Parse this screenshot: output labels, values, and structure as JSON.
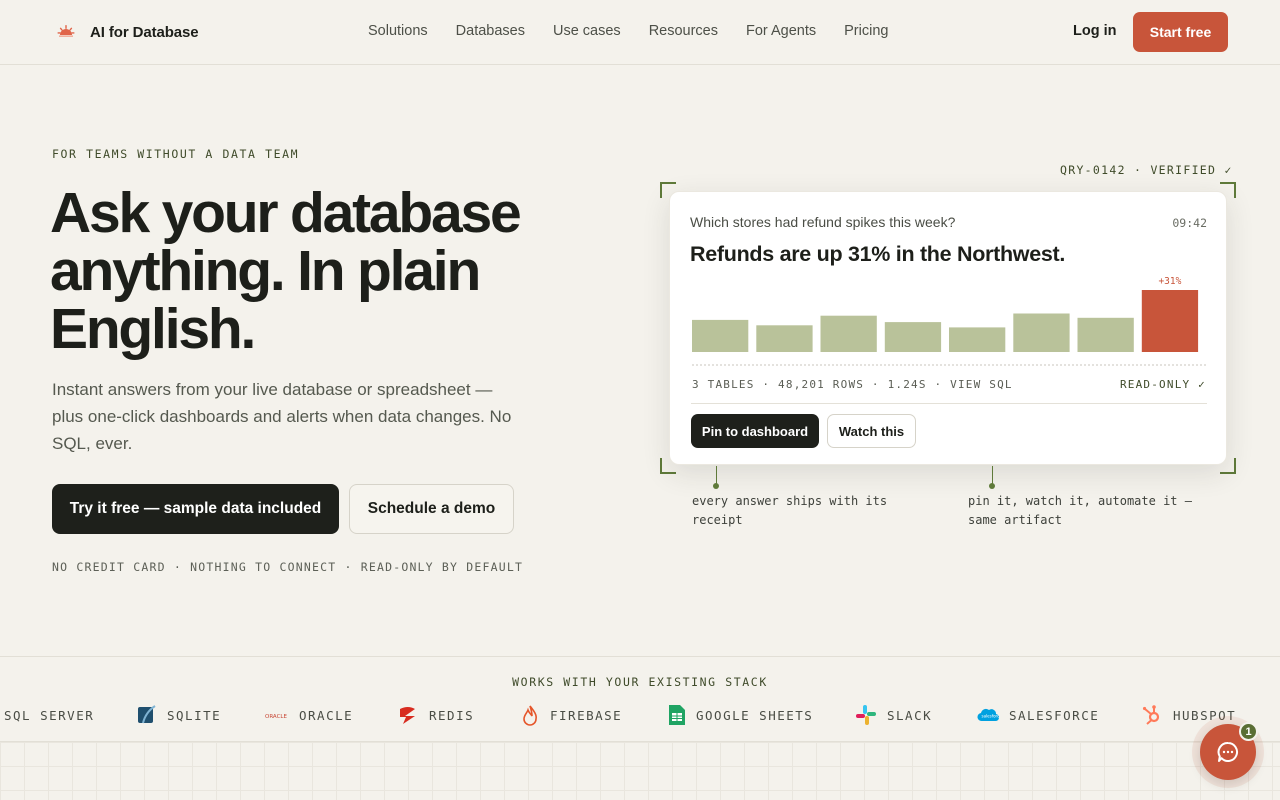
{
  "header": {
    "brand": "AI for Database",
    "nav": [
      "Solutions",
      "Databases",
      "Use cases",
      "Resources",
      "For Agents",
      "Pricing"
    ],
    "login": "Log in",
    "cta": "Start free"
  },
  "hero": {
    "eyebrow": "FOR TEAMS WITHOUT A DATA TEAM",
    "headline": "Ask your database anything. In plain English.",
    "subtext": "Instant answers from your live database or spreadsheet — plus one-click dashboards and alerts when data changes. No SQL, ever.",
    "primary_cta": "Try it free — sample data included",
    "secondary_cta": "Schedule a demo",
    "fineprint": "NO CREDIT CARD · NOTHING TO CONNECT · READ-ONLY BY DEFAULT"
  },
  "card": {
    "verified": "QRY-0142 · VERIFIED ✓",
    "question": "Which stores had refund spikes this week?",
    "time": "09:42",
    "answer": "Refunds are up 31% in the Northwest.",
    "highlight_label": "+31%",
    "meta": "3 TABLES · 48,201 ROWS · 1.24S · VIEW SQL",
    "readonly": "READ-ONLY ✓",
    "pin": "Pin to dashboard",
    "watch": "Watch this",
    "note_left": "every answer ships with its receipt",
    "note_right": "pin it, watch it, automate it — same artifact"
  },
  "chart_data": {
    "type": "bar",
    "values": [
      30,
      25,
      34,
      28,
      23,
      36,
      32,
      58
    ],
    "highlight_index": 7,
    "colors": {
      "bar": "#b9c29a",
      "highlight": "#c8553a"
    }
  },
  "stack": {
    "label": "WORKS WITH YOUR EXISTING STACK",
    "items": [
      {
        "name": "SQL SERVER",
        "icon": "sqlserver-icon"
      },
      {
        "name": "SQLITE",
        "icon": "sqlite-icon"
      },
      {
        "name": "ORACLE",
        "icon": "oracle-icon",
        "mark": "ORACLE"
      },
      {
        "name": "REDIS",
        "icon": "redis-icon"
      },
      {
        "name": "FIREBASE",
        "icon": "firebase-icon"
      },
      {
        "name": "GOOGLE SHEETS",
        "icon": "google-sheets-icon"
      },
      {
        "name": "SLACK",
        "icon": "slack-icon"
      },
      {
        "name": "SALESFORCE",
        "icon": "salesforce-icon",
        "mark": "salesforce"
      },
      {
        "name": "HUBSPOT",
        "icon": "hubspot-icon"
      }
    ]
  },
  "chat": {
    "badge": "1"
  },
  "colors": {
    "accent": "#c8553a",
    "dark": "#1e201b",
    "olive": "#5f7a3a",
    "background": "#f4f2ec"
  }
}
